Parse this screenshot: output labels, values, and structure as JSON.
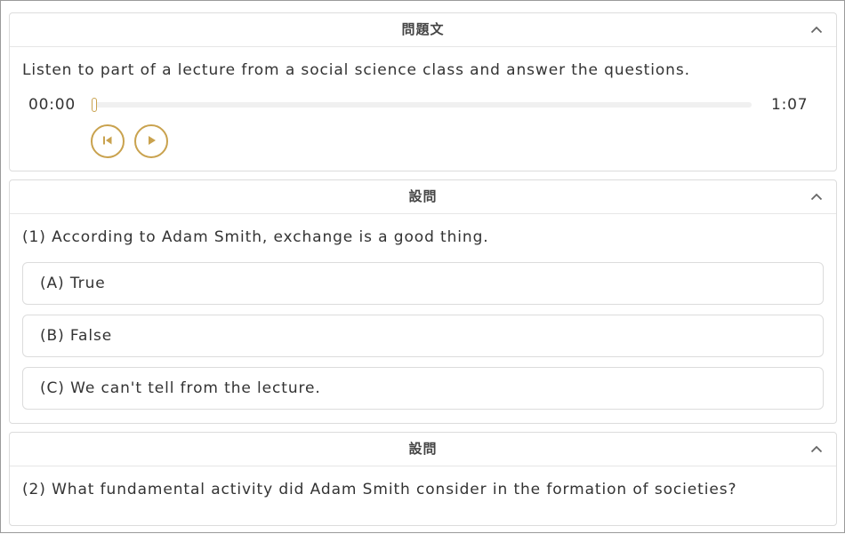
{
  "passage_panel": {
    "header": "問題文",
    "prompt": "Listen to part of a lecture from a social science class and answer the questions.",
    "audio": {
      "current_time": "00:00",
      "duration": "1:07",
      "progress": 0,
      "controls": [
        "restart-icon",
        "play-icon"
      ]
    }
  },
  "question_panels": [
    {
      "header": "設問",
      "question": "(1) According to Adam Smith, exchange is a good thing.",
      "options": [
        {
          "label": "(A) True"
        },
        {
          "label": "(B) False"
        },
        {
          "label": "(C) We can't tell from the lecture."
        }
      ]
    },
    {
      "header": "設問",
      "question": "(2) What fundamental activity did Adam Smith consider in the formation of societies?"
    }
  ],
  "colors": {
    "accent": "#c9a24e",
    "border": "#dcdcdc",
    "text": "#333333"
  }
}
